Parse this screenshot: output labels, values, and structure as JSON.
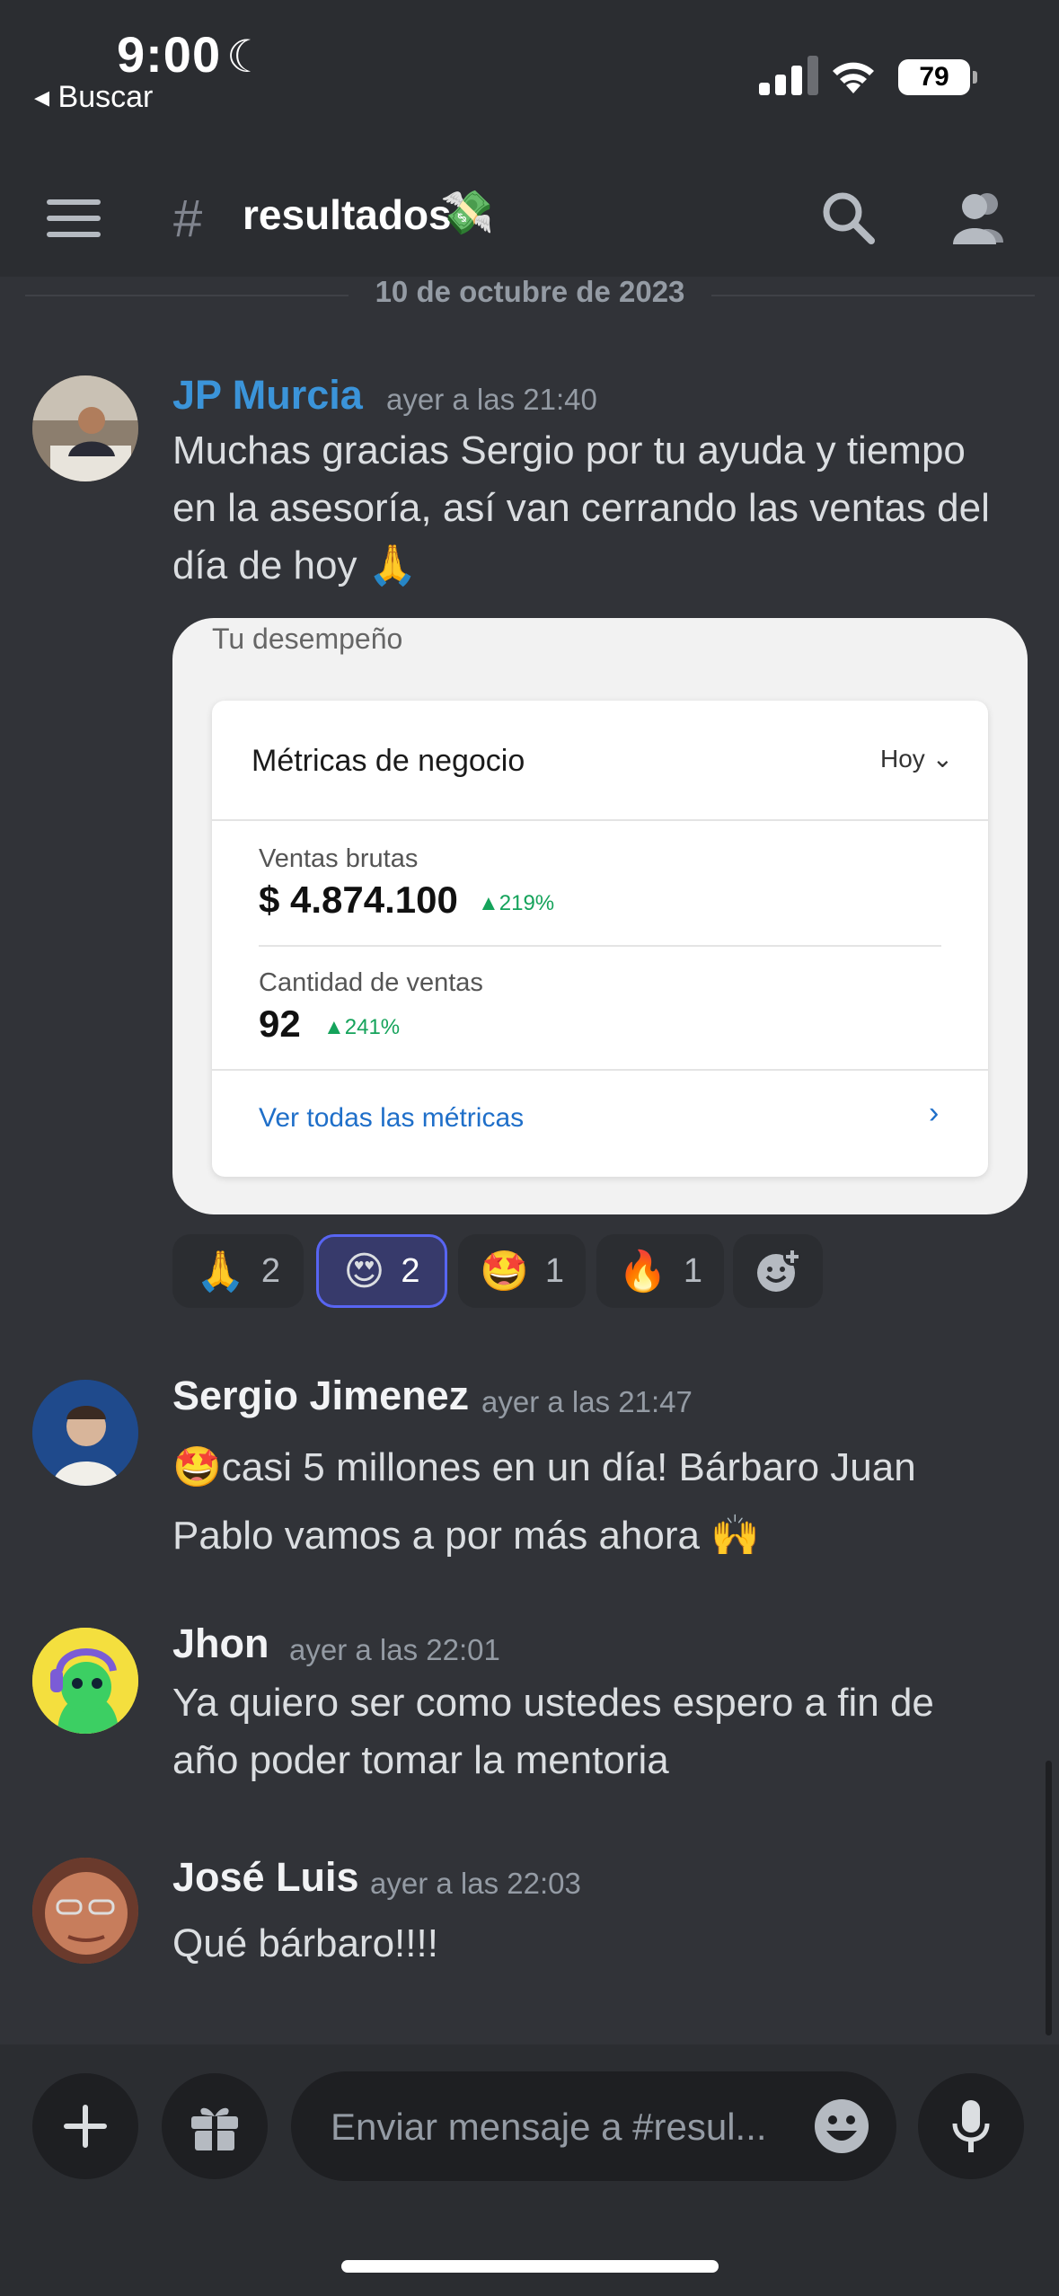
{
  "status_bar": {
    "time": "9:00",
    "back_label": "◂ Buscar",
    "battery": "79"
  },
  "header": {
    "hash": "#",
    "channel": "resultados",
    "channel_emoji": "💸"
  },
  "date_divider": "10 de octubre de 2023",
  "messages": [
    {
      "author": "JP Murcia",
      "author_color": "#3b94d9",
      "timestamp": "ayer a las 21:40",
      "lines": [
        "Muchas gracias Sergio por tu ayuda y tiempo",
        "en la asesoría, así van cerrando las ventas del",
        "día de hoy 🙏"
      ]
    },
    {
      "author": "Sergio Jimenez",
      "timestamp": "ayer a las 21:47",
      "lines": [
        "🤩casi 5 millones en un día! Bárbaro Juan",
        "Pablo vamos a por más ahora 🙌"
      ]
    },
    {
      "author": "Jhon",
      "timestamp": "ayer a las 22:01",
      "lines": [
        "Ya quiero ser como ustedes espero a fin de",
        "año poder tomar la mentoria"
      ]
    },
    {
      "author": "José Luis",
      "timestamp": "ayer a las 22:03",
      "lines": [
        "Qué bárbaro!!!!"
      ]
    }
  ],
  "embed": {
    "header": "Tu desempeño",
    "card_title": "Métricas de negocio",
    "period": "Hoy ⌄",
    "metric1_label": "Ventas brutas",
    "metric1_value": "$ 4.874.100",
    "metric1_change": "▲219%",
    "metric2_label": "Cantidad de ventas",
    "metric2_value": "92",
    "metric2_change": "▲241%",
    "link": "Ver todas las métricas",
    "link_arrow": "›"
  },
  "reactions": [
    {
      "emoji": "🙏",
      "count": "2",
      "active": false
    },
    {
      "emoji": "😍",
      "count": "2",
      "active": true
    },
    {
      "emoji": "🤩",
      "count": "1",
      "active": false
    },
    {
      "emoji": "🔥",
      "count": "1",
      "active": false
    }
  ],
  "composer": {
    "placeholder": "Enviar mensaje a #resul..."
  }
}
